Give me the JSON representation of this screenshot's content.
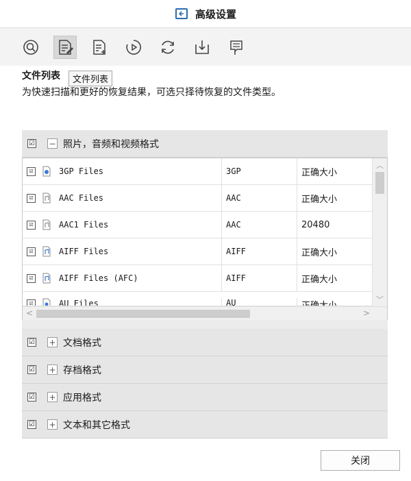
{
  "window": {
    "title": "高级设置",
    "title_icon": "back-arrow-icon"
  },
  "toolbar": {
    "items": [
      {
        "icon": "scan-icon",
        "active": false
      },
      {
        "icon": "file-list-icon",
        "active": true
      },
      {
        "icon": "file-add-icon",
        "active": false
      },
      {
        "icon": "play-icon",
        "active": false
      },
      {
        "icon": "refresh-icon",
        "active": false
      },
      {
        "icon": "download-icon",
        "active": false
      },
      {
        "icon": "flag-icon",
        "active": false
      }
    ]
  },
  "section": {
    "title": "文件列表",
    "tooltip": "文件列表",
    "description": "为快速扫描和更好的恢复结果，可选只择待恢复的文件类型。"
  },
  "categories": [
    {
      "label": "照片，音频和视频格式",
      "checked": true,
      "expanded": true,
      "expander": "−"
    },
    {
      "label": "文档格式",
      "checked": true,
      "expanded": false,
      "expander": "+"
    },
    {
      "label": "存档格式",
      "checked": true,
      "expanded": false,
      "expander": "+"
    },
    {
      "label": "应用格式",
      "checked": true,
      "expanded": false,
      "expander": "+"
    },
    {
      "label": "文本和其它格式",
      "checked": true,
      "expanded": false,
      "expander": "+"
    }
  ],
  "file_rows": [
    {
      "name": "3GP Files",
      "ext": "3GP",
      "size": "正确大小",
      "checked": true,
      "icon": "video-file-icon"
    },
    {
      "name": "AAC Files",
      "ext": "AAC",
      "size": "正确大小",
      "checked": true,
      "icon": "audio-file-icon"
    },
    {
      "name": "AAC1 Files",
      "ext": "AAC",
      "size": "20480",
      "checked": true,
      "icon": "audio-file-icon"
    },
    {
      "name": "AIFF Files",
      "ext": "AIFF",
      "size": "正确大小",
      "checked": true,
      "icon": "music-file-icon"
    },
    {
      "name": "AIFF Files (AFC)",
      "ext": "AIFF",
      "size": "正确大小",
      "checked": true,
      "icon": "music-file-icon"
    },
    {
      "name": "AU Files",
      "ext": "AU",
      "size": "正确大小",
      "checked": true,
      "icon": "sound-file-icon"
    }
  ],
  "checkmark": "☑",
  "close_button": "关闭",
  "colors": {
    "accent": "#2b6cb0",
    "panel": "#e6e6e6",
    "toolbar": "#f3f3f3"
  }
}
